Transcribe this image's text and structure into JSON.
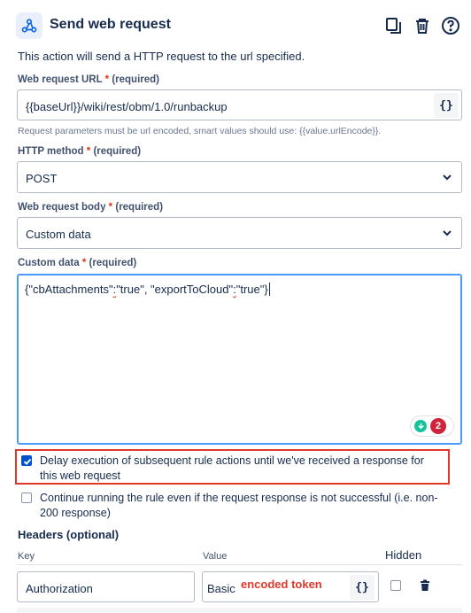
{
  "header": {
    "title": "Send web request",
    "icons": [
      "webhook-icon",
      "duplicate-icon",
      "trash-icon",
      "help-icon"
    ]
  },
  "description": "This action will send a HTTP request to the url specified.",
  "url_field": {
    "label": "Web request URL",
    "required_marker": "*",
    "required_text": "(required)",
    "value": "{{baseUrl}}/wiki/rest/obm/1.0/runbackup",
    "smart_value_button": "{}",
    "help": "Request parameters must be url encoded, smart values should use: {{value.urlEncode}}."
  },
  "method_field": {
    "label": "HTTP method",
    "required_marker": "*",
    "required_text": "(required)",
    "value": "POST"
  },
  "body_field": {
    "label": "Web request body",
    "required_marker": "*",
    "required_text": "(required)",
    "value": "Custom data"
  },
  "custom_data_field": {
    "label": "Custom data",
    "required_marker": "*",
    "required_text": "(required)",
    "value_parts": [
      "{\"cbAttachments\"",
      ":",
      "\"true\", \"exportToCloud\"",
      ":",
      "\"true\"}"
    ],
    "grammar_count": "2"
  },
  "options": {
    "delay": {
      "checked": true,
      "label_line1": "Delay execution of subsequent rule actions until we've received a response for",
      "label_line2": "this web request"
    },
    "continue": {
      "checked": false,
      "label_line1": "Continue running the rule even if the request response is not successful (i.e. non-",
      "label_line2": "200 response)"
    }
  },
  "headers": {
    "title": "Headers (optional)",
    "col_key": "Key",
    "col_value": "Value",
    "col_hidden": "Hidden",
    "rows": [
      {
        "key": "Authorization",
        "value_prefix": "Basic",
        "value_overlay": "encoded token",
        "smart_value_button": "{}",
        "hidden": false
      }
    ]
  },
  "colors": {
    "accent": "#0052cc",
    "focus_border": "#4c9aff",
    "highlight_red": "#e0382a",
    "required_red": "#de350b"
  }
}
